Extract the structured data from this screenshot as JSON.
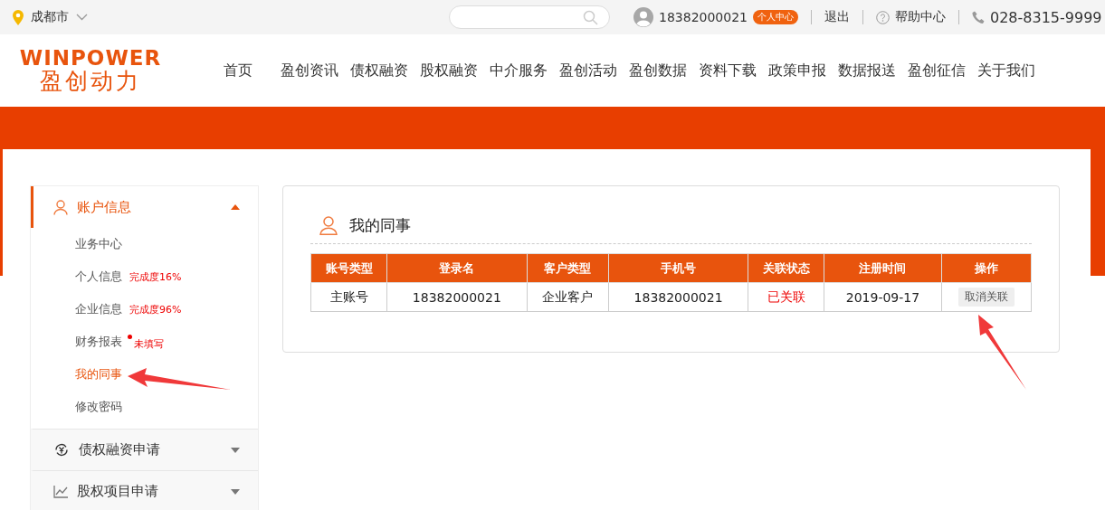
{
  "top_bar": {
    "city": "成都市",
    "user_phone": "18382000021",
    "user_center_badge": "个人中心",
    "logout": "退出",
    "help": "帮助中心",
    "hotline": "028-8315-9999"
  },
  "logo": {
    "latin": "WINPOWER",
    "chinese": "盈创动力"
  },
  "nav": [
    {
      "label": "首页",
      "selected": false
    },
    {
      "label": "盈创资讯",
      "selected": false
    },
    {
      "label": "债权融资",
      "selected": false
    },
    {
      "label": "股权融资",
      "selected": false
    },
    {
      "label": "中介服务",
      "selected": false
    },
    {
      "label": "盈创活动",
      "selected": false
    },
    {
      "label": "盈创数据",
      "selected": false
    },
    {
      "label": "资料下载",
      "selected": false
    },
    {
      "label": "政策申报",
      "selected": false
    },
    {
      "label": "数据报送",
      "selected": false
    },
    {
      "label": "盈创征信",
      "selected": false
    },
    {
      "label": "关于我们",
      "selected": false
    }
  ],
  "sidebar": [
    {
      "label": "账户信息",
      "selected": true,
      "expanded": true,
      "children": [
        {
          "label": "业务中心",
          "selected": false
        },
        {
          "label": "个人信息",
          "note": "完成度16%",
          "selected": false
        },
        {
          "label": "企业信息",
          "note": "完成度96%",
          "selected": false
        },
        {
          "label": "财务报表",
          "note": "未填写",
          "flagged": true,
          "selected": false
        },
        {
          "label": "我的同事",
          "selected": true
        },
        {
          "label": "修改密码",
          "selected": false
        }
      ]
    },
    {
      "label": "债权融资申请",
      "selected": false,
      "expanded": false
    },
    {
      "label": "股权项目申请",
      "selected": false,
      "expanded": false
    }
  ],
  "panel": {
    "title": "我的同事",
    "table": {
      "columns": [
        "账号类型",
        "登录名",
        "客户类型",
        "手机号",
        "关联状态",
        "注册时间",
        "操作"
      ],
      "rows": [
        [
          {
            "kind": "text",
            "text": "主账号"
          },
          {
            "kind": "text",
            "text": "18382000021"
          },
          {
            "kind": "text",
            "text": "企业客户"
          },
          {
            "kind": "text",
            "text": "18382000021"
          },
          {
            "kind": "status",
            "text": "已关联"
          },
          {
            "kind": "text",
            "text": "2019-09-17"
          },
          {
            "kind": "action",
            "text": "取消关联"
          }
        ]
      ]
    }
  }
}
